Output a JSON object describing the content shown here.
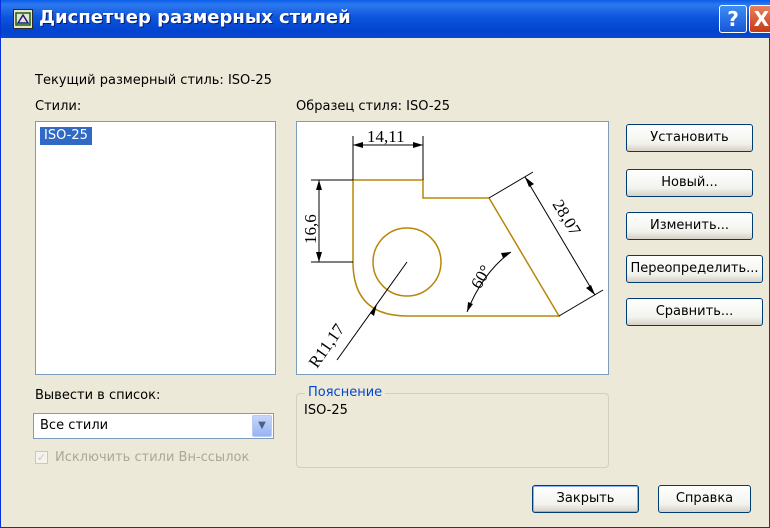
{
  "window": {
    "title": "Диспетчер размерных стилей",
    "help_label": "?",
    "close_label": "X"
  },
  "current_style": "Текущий размерный стиль: ISO-25",
  "styles": {
    "label": "Стили:",
    "items": [
      "ISO-25"
    ],
    "selected_index": 0
  },
  "preview": {
    "label": "Образец стиля: ISO-25",
    "dimensions": {
      "width_top": "14,11",
      "height_left": "16,6",
      "slant": "28,07",
      "angle": "60°",
      "radius": "R11,17"
    }
  },
  "list_filter": {
    "label": "Вывести в список:",
    "value": "Все стили",
    "exclude_xref_label": "Исключить стили Вн-ссылок",
    "exclude_xref_checked": true
  },
  "description": {
    "legend": "Пояснение",
    "text": "ISO-25"
  },
  "buttons": {
    "set_current": "Установить",
    "new": "Новый...",
    "modify": "Изменить...",
    "override": "Переопределить...",
    "compare": "Сравнить...",
    "close": "Закрыть",
    "help": "Справка"
  },
  "colors": {
    "titlebar": "#0a5ce8",
    "selection": "#316ac5",
    "drawing_line": "#b8860b",
    "legend_text": "#0046d5"
  }
}
